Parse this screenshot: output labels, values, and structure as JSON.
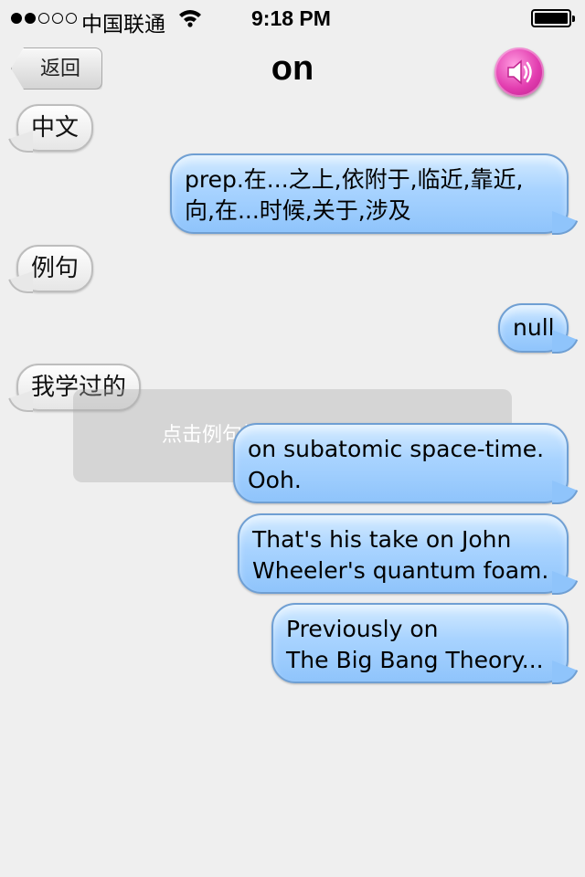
{
  "status_bar": {
    "signal_dots_filled": 2,
    "signal_dots_total": 5,
    "carrier": "中国联通",
    "time": "9:18 PM",
    "battery_level": 1.0
  },
  "nav": {
    "back_label": "返回",
    "title": "on",
    "speaker_icon": "speaker-icon"
  },
  "sections": {
    "chinese_label": "中文",
    "chinese_definition": [
      "prep.在...之上,依附于,临近,靠近,",
      "向,在...时候,关于,涉及"
    ],
    "example_label": "例句",
    "example_value": "null",
    "learned_label": "我学过的",
    "learned_examples": [
      [
        "on subatomic space-time.",
        "Ooh."
      ],
      [
        "That's his take on John",
        "Wheeler's quantum foam."
      ],
      [
        "Previously on",
        "The Big Bang Theory..."
      ]
    ]
  },
  "toast": "点击例句播放对应的视频短片",
  "colors": {
    "background": "#efefef",
    "blue_bubble": "#a8d3ff",
    "gray_bubble": "#f2f2f2",
    "speaker_accent": "#e23caf"
  }
}
